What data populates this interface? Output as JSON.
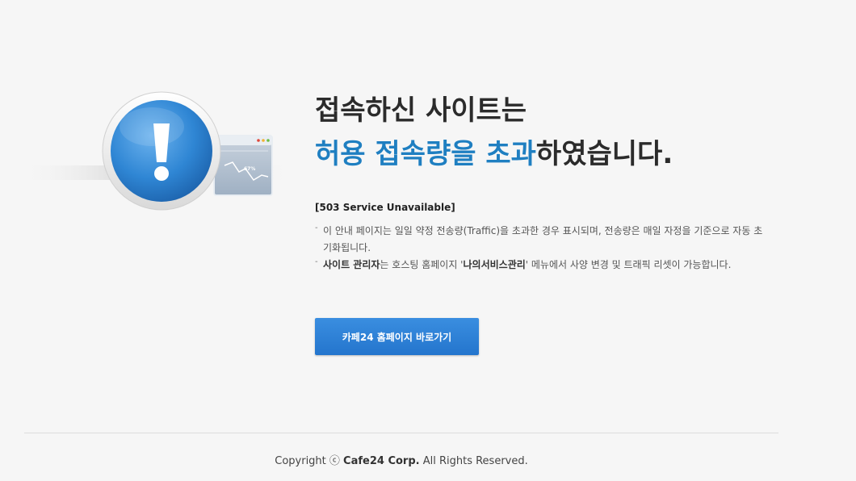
{
  "headline": {
    "line1": "접속하신 사이트는",
    "line2_accent": "허용 접속량을 초과",
    "line2_rest": "하였습니다."
  },
  "status_code": "[503 Service Unavailable]",
  "notices": [
    {
      "text": "이 안내 페이지는 일일 약정 전송량(Traffic)을 초과한 경우 표시되며, 전송량은 매일 자정을 기준으로 자동 초기화됩니다."
    },
    {
      "bold1": "사이트 관리자",
      "text1": "는 호스팅 홈페이지 '",
      "bold2": "나의서비스관리",
      "text2": "' 메뉴에서 사양 변경 및 트래픽 리셋이 가능합니다."
    }
  ],
  "button_label": "카페24 홈페이지 바로가기",
  "illustration": {
    "icon": "exclamation-icon",
    "window_percent": "67%"
  },
  "footer": {
    "prefix": "Copyright ⓒ ",
    "company": "Cafe24 Corp.",
    "suffix": " All Rights Reserved."
  },
  "colors": {
    "accent": "#1f7fc1",
    "button": "#2f82d6",
    "background": "#f6f6f6"
  }
}
